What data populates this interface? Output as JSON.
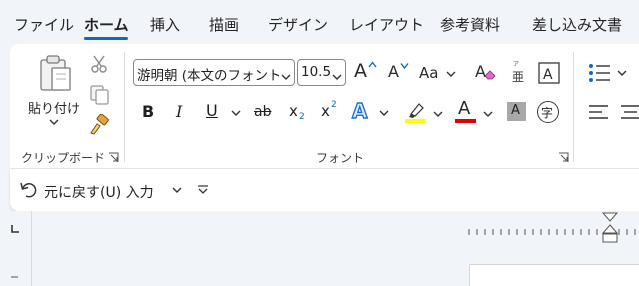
{
  "tabs": [
    {
      "label": "ファイル",
      "active": false
    },
    {
      "label": "ホーム",
      "active": true
    },
    {
      "label": "挿入",
      "active": false
    },
    {
      "label": "描画",
      "active": false
    },
    {
      "label": "デザイン",
      "active": false
    },
    {
      "label": "レイアウト",
      "active": false
    },
    {
      "label": "参考資料",
      "active": false
    },
    {
      "label": "差し込み文書",
      "active": false
    }
  ],
  "clipboard": {
    "paste_label": "貼り付け",
    "group_label": "クリップボード"
  },
  "font": {
    "name_value": "游明朝 (本文のフォント",
    "size_value": "10.5",
    "group_label": "フォント",
    "grow_label": "A",
    "shrink_label": "A",
    "case_label": "Aa",
    "phonetic_label": "亜",
    "bold_label": "B",
    "italic_label": "I",
    "underline_label": "U",
    "strike_label": "ab",
    "subscript_label": "x",
    "subscript_sub": "2",
    "superscript_label": "x",
    "superscript_sup": "2",
    "effects_label": "A",
    "font_color_label": "A",
    "shading_label": "A",
    "enclose_label": "字"
  },
  "qat": {
    "undo_label": "元に戻す(U) 入力"
  },
  "colors": {
    "accent": "#0f6cbd",
    "highlight": "#ffff00",
    "font_color": "#e00000"
  }
}
